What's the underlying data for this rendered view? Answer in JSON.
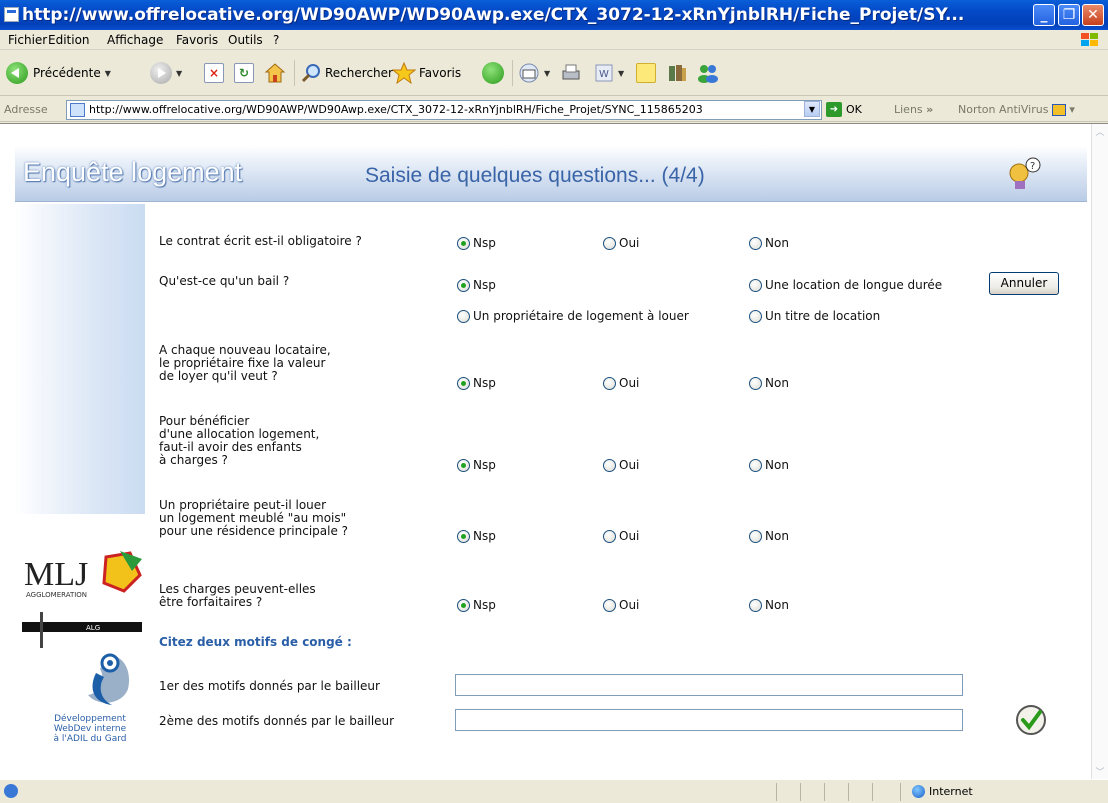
{
  "window": {
    "title": "http://www.offrelocative.org/WD90AWP/WD90Awp.exe/CTX_3072-12-xRnYjnblRH/Fiche_Projet/SY...",
    "min_glyph": "_",
    "max_glyph": "❐",
    "close_glyph": "✕"
  },
  "menu": [
    "Fichier",
    "Edition",
    "Affichage",
    "Favoris",
    "Outils",
    "?"
  ],
  "toolbar": {
    "back_label": "Précédente",
    "search_label": "Rechercher",
    "favorites_label": "Favoris"
  },
  "address_bar": {
    "label": "Adresse",
    "url": "http://www.offrelocative.org/WD90AWP/WD90Awp.exe/CTX_3072-12-xRnYjnblRH/Fiche_Projet/SYNC_115865203",
    "go_label": "OK",
    "links_label": "Liens",
    "norton_label": "Norton AntiVirus"
  },
  "page": {
    "title": "Enquête logement",
    "subtitle": "Saisie de quelques questions... (4/4)",
    "cancel_button": "Annuler",
    "section_label": "Citez deux motifs de congé :",
    "motif1_label": "1er des motifs donnés par le bailleur",
    "motif2_label": "2ème des motifs donnés par le bailleur",
    "motif1_value": "",
    "motif2_value": "",
    "logo_mlj_text": "MLJ",
    "logo_mlj_sub": "AGGLOMERATION",
    "logo_alg_text": "ALG",
    "dev_credit": "Développement\nWebDev interne\nà l'ADIL du Gard"
  },
  "questions": [
    {
      "text": "Le contrat écrit est-il obligatoire ?",
      "options": [
        "Nsp",
        "Oui",
        "Non"
      ],
      "selected": 0
    },
    {
      "text": "Qu'est-ce qu'un bail ?",
      "options": [
        "Nsp",
        "Une location de longue durée",
        "Un propriétaire de logement à louer",
        "Un titre de location"
      ],
      "selected": 0
    },
    {
      "text": "A chaque nouveau locataire,\nle propriétaire fixe la valeur\nde loyer qu'il veut ?",
      "options": [
        "Nsp",
        "Oui",
        "Non"
      ],
      "selected": 0
    },
    {
      "text": "Pour bénéficier\nd'une allocation logement,\nfaut-il avoir des enfants\nà charges ?",
      "options": [
        "Nsp",
        "Oui",
        "Non"
      ],
      "selected": 0
    },
    {
      "text": "Un propriétaire peut-il louer\nun logement meublé \"au mois\"\npour une résidence principale ?",
      "options": [
        "Nsp",
        "Oui",
        "Non"
      ],
      "selected": 0
    },
    {
      "text": "Les charges peuvent-elles\nêtre forfaitaires ?",
      "options": [
        "Nsp",
        "Oui",
        "Non"
      ],
      "selected": 0
    }
  ],
  "status_bar": {
    "zone_label": "Internet"
  },
  "colors": {
    "titlebar": "#0348c6",
    "header_title": "#ffffff",
    "header_subtitle": "#3a64a8",
    "section_label": "#2a5fa8",
    "radio_dot": "#21a121"
  }
}
